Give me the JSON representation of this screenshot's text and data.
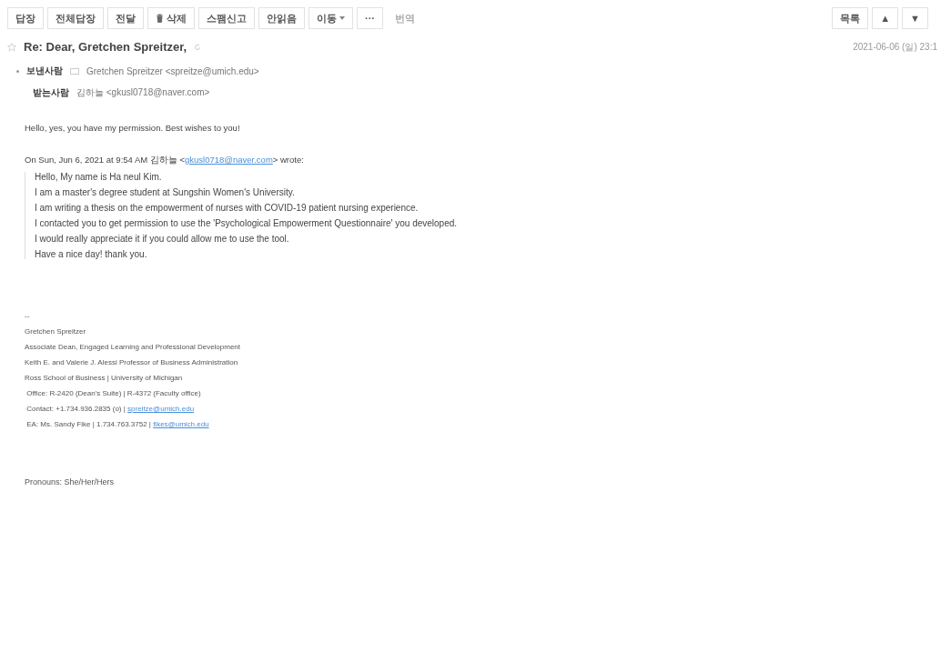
{
  "toolbar": {
    "buttons": [
      {
        "label": "답장",
        "kind": "text"
      },
      {
        "label": "전체답장",
        "kind": "text"
      },
      {
        "label": "전달",
        "kind": "text"
      },
      {
        "label": "삭제",
        "kind": "trash"
      },
      {
        "label": "스팸신고",
        "kind": "text"
      },
      {
        "label": "안읽음",
        "kind": "text"
      },
      {
        "label": "이동",
        "kind": "dropdown"
      },
      {
        "label": "···",
        "kind": "text"
      },
      {
        "label": "번역",
        "kind": "plain"
      }
    ],
    "right": [
      {
        "label": "목록"
      },
      {
        "label": "▲"
      },
      {
        "label": "▼"
      }
    ]
  },
  "subject": {
    "text": "Re: Dear, Gretchen Spreitzer,",
    "starred": false,
    "date": "2021-06-06 (일) 23:1"
  },
  "sender": {
    "label": "보낸사람",
    "value": "Gretchen Spreitzer <spreitze@umich.edu>"
  },
  "recipient": {
    "label": "받는사람",
    "value": "김하늘 <gkusl0718@naver.com>"
  },
  "body": {
    "reply": "Hello, yes, you have my permission.  Best wishes to you!",
    "quote_header": {
      "before": "On Sun, Jun 6, 2021 at 9:54 AM 김하늘 <",
      "link": "gkusl0718@naver.com",
      "after": "> wrote:"
    },
    "quoted": [
      "Hello, My name is Ha neul Kim.",
      "I am a master's degree student at Sungshin Women's University.",
      "I am writing a thesis on the empowerment of nurses with COVID-19 patient nursing experience.",
      "I contacted you to get permission to use the 'Psychological Empowerment Questionnaire' you developed.",
      "I would really appreciate it if you could allow me to use the tool.",
      "Have a nice day! thank you."
    ],
    "signature": {
      "separator": "--",
      "lines": [
        {
          "text": "Gretchen Spreitzer"
        },
        {
          "text": "Associate Dean, Engaged Learning and Professional Development"
        },
        {
          "text": "Keith E. and Valerie J. Alessi Professor of Business Administration"
        },
        {
          "text": "Ross School of Business | University of Michigan"
        },
        {
          "text": " Office: R-2420 (Dean's Suite) | R-4372 (Faculty office)"
        },
        {
          "text": " Contact: +1.734.936.2835 (o) | ",
          "link": "spreitze@umich.edu"
        },
        {
          "text": " EA: Ms. Sandy Fike | 1.734.763.3752 | ",
          "link": "fikes@umich.edu"
        }
      ]
    },
    "pronouns": "Pronouns: She/Her/Hers"
  }
}
